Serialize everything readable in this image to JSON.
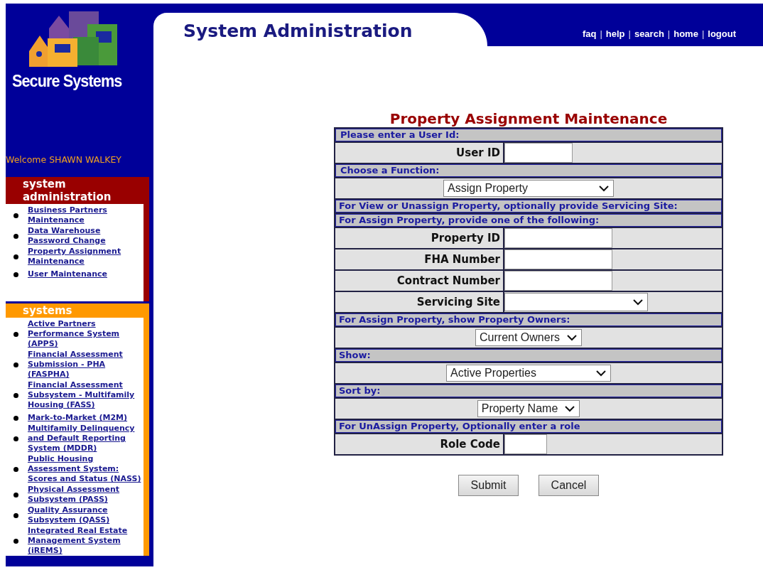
{
  "sidebar": {
    "brand": "Secure Systems",
    "welcome": "Welcome SHAWN WALKEY",
    "sections": [
      {
        "title": "system administration",
        "color": "#990000",
        "links": [
          "Business Partners Maintenance",
          "Data Warehouse Password Change",
          "Property Assignment Maintenance",
          "User Maintenance"
        ]
      },
      {
        "title": "systems",
        "color": "#ff9900",
        "links": [
          "Active Partners Performance System (APPS)",
          "Financial Assessment Submission - PHA (FASPHA)",
          "Financial Assessment Subsystem - Multifamily Housing (FASS)",
          "Mark-to-Market (M2M)",
          "Multifamily Delinquency and Default Reporting System (MDDR)",
          "Public Housing Assessment System: Scores and Status (NASS)",
          "Physical Assessment Subsystem (PASS)",
          "Quality Assurance Subsystem (QASS)",
          "Integrated Real Estate Management System (iREMS)"
        ]
      }
    ]
  },
  "header": {
    "title": "System Administration",
    "nav": [
      {
        "kind": "link",
        "label": "faq"
      },
      {
        "kind": "separator",
        "label": "|"
      },
      {
        "kind": "link",
        "label": "help"
      },
      {
        "kind": "separator",
        "label": "|"
      },
      {
        "kind": "link",
        "label": "search"
      },
      {
        "kind": "separator",
        "label": "|"
      },
      {
        "kind": "link",
        "label": "home"
      },
      {
        "kind": "separator",
        "label": "|"
      },
      {
        "kind": "link",
        "label": "logout"
      }
    ]
  },
  "form": {
    "title": "Property Assignment Maintenance",
    "rows": [
      {
        "kind": "section",
        "text": "Please enter a User Id:"
      },
      {
        "kind": "short-input",
        "label": "User ID"
      },
      {
        "kind": "section",
        "text": "Choose a Function:"
      },
      {
        "kind": "select",
        "value": "Assign Property"
      },
      {
        "kind": "section",
        "text": "For View or Unassign Property, optionally provide Servicing Site:"
      },
      {
        "kind": "section",
        "text": "For Assign Property, provide one of the following:"
      },
      {
        "kind": "input",
        "label": "Property ID"
      },
      {
        "kind": "input",
        "label": "FHA Number"
      },
      {
        "kind": "input",
        "label": "Contract Number"
      },
      {
        "kind": "labeled-select",
        "label": "Servicing Site"
      },
      {
        "kind": "section",
        "text": "For Assign Property, show Property Owners:"
      },
      {
        "kind": "select",
        "value": "Current Owners"
      },
      {
        "kind": "section",
        "text": "Show:"
      },
      {
        "kind": "select",
        "value": "Active Properties"
      },
      {
        "kind": "section",
        "text": "Sort by:"
      },
      {
        "kind": "select",
        "value": "Property Name"
      },
      {
        "kind": "section",
        "text": "For UnAssign Property, Optionally enter a role"
      },
      {
        "kind": "tiny-input",
        "label": "Role Code"
      }
    ],
    "buttons": [
      "Submit",
      "Cancel"
    ]
  }
}
